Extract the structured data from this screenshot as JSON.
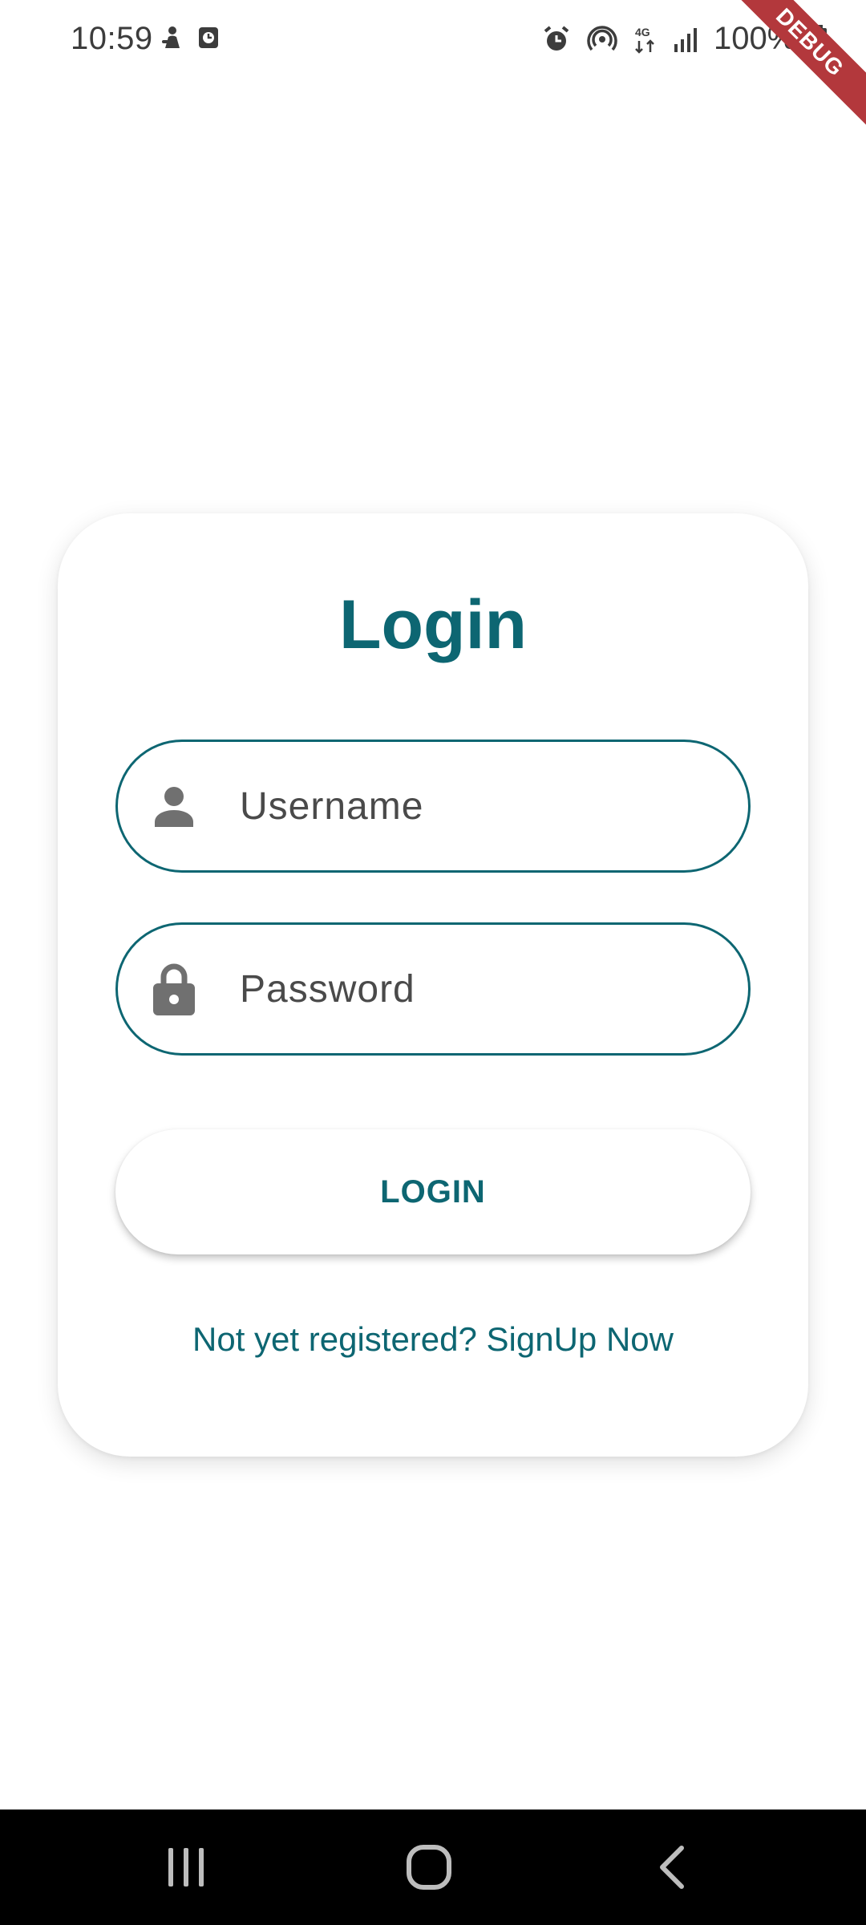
{
  "status_bar": {
    "time": "10:59",
    "battery": "100%",
    "left_icons": [
      "person-icon",
      "clock-badge-icon"
    ],
    "right_icons": [
      "alarm-icon",
      "hotspot-icon",
      "4g-icon",
      "signal-icon",
      "battery-icon"
    ]
  },
  "debug_banner": "DEBUG",
  "login": {
    "title": "Login",
    "username_placeholder": "Username",
    "password_placeholder": "Password",
    "button_label": "LOGIN",
    "signup_text": "Not yet registered? SignUp Now"
  },
  "colors": {
    "accent": "#0d6672",
    "debug": "#b3383c",
    "icon_gray": "#707070"
  },
  "nav": {
    "buttons": [
      "recents-icon",
      "home-icon",
      "back-icon"
    ]
  }
}
